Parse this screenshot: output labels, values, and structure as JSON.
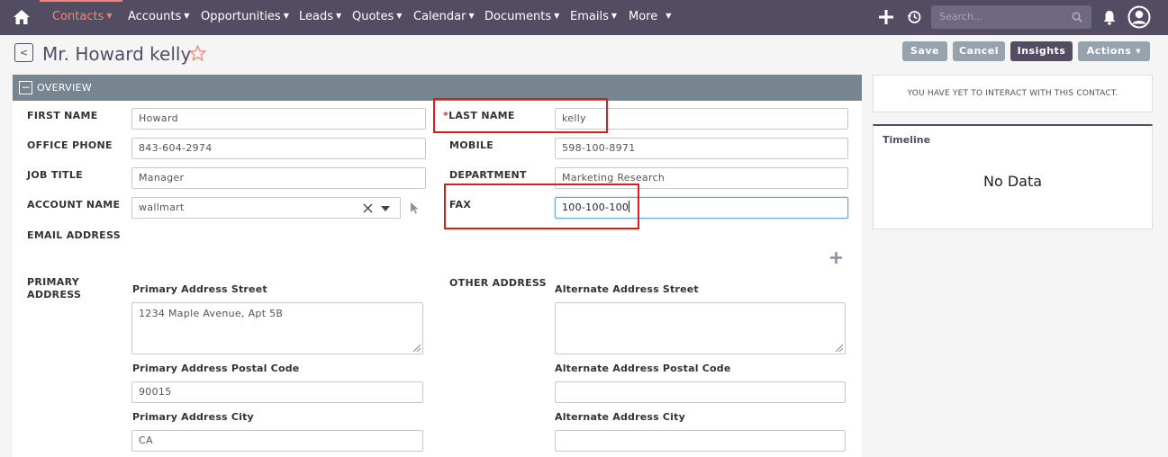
{
  "nav": {
    "items": [
      {
        "label": "Contacts",
        "active": true
      },
      {
        "label": "Accounts"
      },
      {
        "label": "Opportunities"
      },
      {
        "label": "Leads"
      },
      {
        "label": "Quotes"
      },
      {
        "label": "Calendar"
      },
      {
        "label": "Documents"
      },
      {
        "label": "Emails"
      },
      {
        "label": "More"
      }
    ],
    "search_placeholder": "Search...",
    "colors": {
      "bar": "#534d64",
      "active": "#f08377"
    }
  },
  "header": {
    "back_icon": "<",
    "title": "Mr. Howard kelly",
    "star_icon": "star-outline-icon"
  },
  "actions": {
    "save": "Save",
    "cancel": "Cancel",
    "insights": "Insights",
    "actions": "Actions"
  },
  "panel": {
    "collapse_icon": "−",
    "title": "OVERVIEW"
  },
  "fields": {
    "first_name": {
      "label": "FIRST NAME",
      "value": "Howard"
    },
    "last_name": {
      "label": "LAST NAME",
      "required_mark": "*",
      "value": "kelly"
    },
    "office_phone": {
      "label": "OFFICE PHONE",
      "value": "843-604-2974"
    },
    "mobile": {
      "label": "MOBILE",
      "value": "598-100-8971"
    },
    "job_title": {
      "label": "JOB TITLE",
      "value": "Manager"
    },
    "department": {
      "label": "DEPARTMENT",
      "value": "Marketing Research"
    },
    "account_name": {
      "label": "ACCOUNT NAME",
      "value": "wallmart"
    },
    "fax": {
      "label": "FAX",
      "value": "100-100-100"
    },
    "email": {
      "label": "EMAIL ADDRESS"
    },
    "primary_address": {
      "label_line1": "PRIMARY",
      "label_line2": "ADDRESS",
      "street_label": "Primary Address Street",
      "street_value": "1234 Maple Avenue, Apt 5B",
      "postal_label": "Primary Address Postal Code",
      "postal_value": "90015",
      "city_label": "Primary Address City",
      "city_value": "CA"
    },
    "other_address": {
      "label": "OTHER ADDRESS",
      "street_label": "Alternate Address Street",
      "street_value": "",
      "postal_label": "Alternate Address Postal Code",
      "postal_value": "",
      "city_label": "Alternate Address City",
      "city_value": ""
    }
  },
  "sidebar": {
    "interaction_text": "YOU HAVE YET TO INTERACT WITH THIS CONTACT.",
    "timeline_title": "Timeline",
    "timeline_empty": "No Data"
  }
}
